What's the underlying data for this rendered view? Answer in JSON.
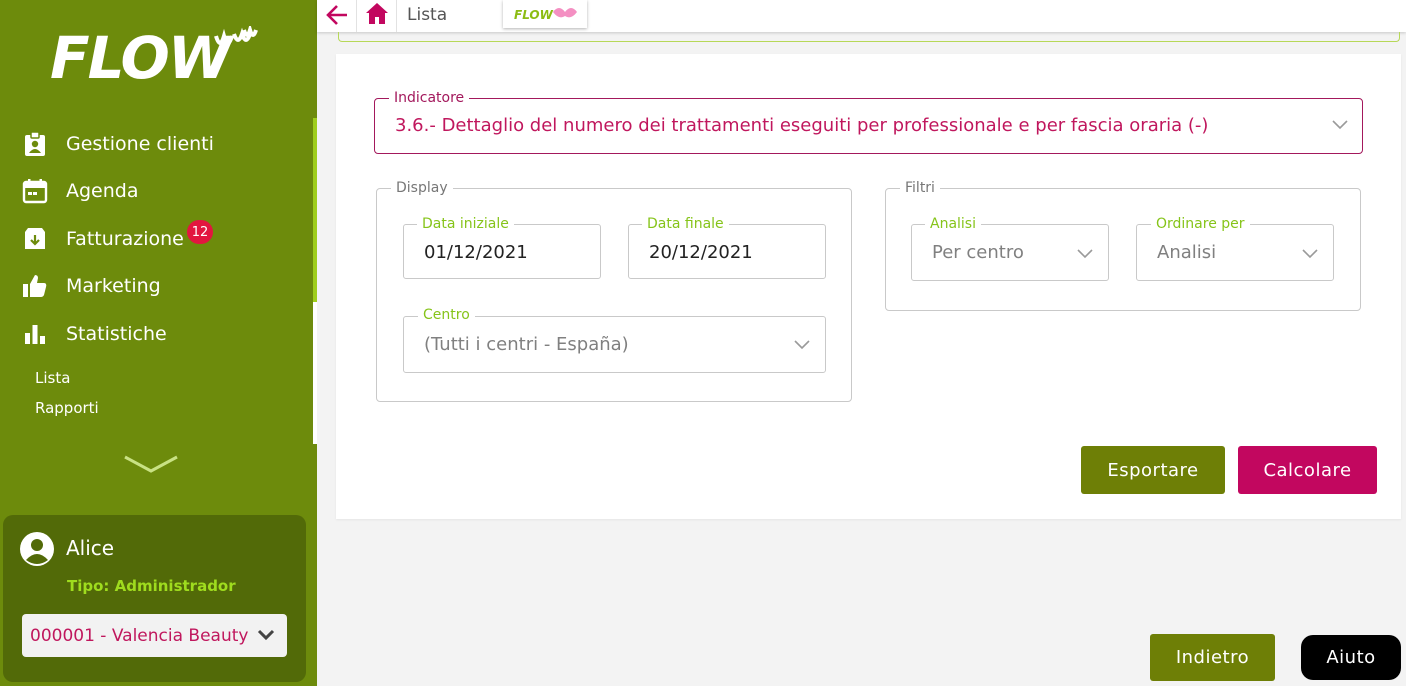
{
  "brand": {
    "logo_text": "FLOW",
    "logo_alt": "Flow logo"
  },
  "sidebar": {
    "items": [
      {
        "label": "Gestione clienti",
        "icon": "clipboard-user-icon"
      },
      {
        "label": "Agenda",
        "icon": "calendar-icon"
      },
      {
        "label": "Fatturazione",
        "icon": "archive-down-icon",
        "badge": "12"
      },
      {
        "label": "Marketing",
        "icon": "thumbs-up-icon"
      },
      {
        "label": "Statistiche",
        "icon": "bar-chart-icon"
      }
    ],
    "subitems": [
      "Lista",
      "Rapporti"
    ]
  },
  "user": {
    "name": "Alice",
    "role": "Tipo: Administrador",
    "center": "000001 - Valencia Beauty"
  },
  "topbar": {
    "title": "Lista"
  },
  "indicator": {
    "label": "Indicatore",
    "value": "3.6.- Dettaglio del numero dei trattamenti eseguiti per professionale e per fascia oraria (-)"
  },
  "display": {
    "legend": "Display",
    "start_date": {
      "label": "Data iniziale",
      "value": "01/12/2021"
    },
    "end_date": {
      "label": "Data finale",
      "value": "20/12/2021"
    },
    "centro": {
      "label": "Centro",
      "value": "(Tutti i centri - España)"
    }
  },
  "filtri": {
    "legend": "Filtri",
    "analisi": {
      "label": "Analisi",
      "value": "Per centro"
    },
    "order": {
      "label": "Ordinare per",
      "value": "Analisi"
    }
  },
  "actions": {
    "export": "Esportare",
    "calculate": "Calcolare",
    "back": "Indietro",
    "help": "Aiuto"
  },
  "colors": {
    "sidebar": "#6d8b0c",
    "accent": "#c2075f",
    "olive_button": "#6e7f06",
    "lime": "#9fce1d"
  }
}
